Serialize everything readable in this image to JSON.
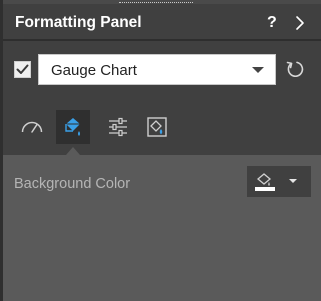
{
  "header": {
    "title": "Formatting Panel",
    "help_label": "?",
    "collapse_icon": "chevron-right-icon"
  },
  "chart_selector": {
    "enabled": true,
    "selected_value": "Gauge Chart",
    "reset_icon": "refresh-icon"
  },
  "tabs": [
    {
      "icon": "gauge-icon",
      "active": false
    },
    {
      "icon": "paint-bucket-icon",
      "active": true
    },
    {
      "icon": "sliders-icon",
      "active": false
    },
    {
      "icon": "image-fill-icon",
      "active": false
    }
  ],
  "background": {
    "label": "Background Color",
    "color_icon": "paint-bucket-icon",
    "swatch_color": "#ffffff"
  },
  "colors": {
    "panel_bg": "#5a5a5a",
    "header_bg": "#404040",
    "accent": "#3aa0e8",
    "active_tab_bg": "#2f2f2f"
  }
}
